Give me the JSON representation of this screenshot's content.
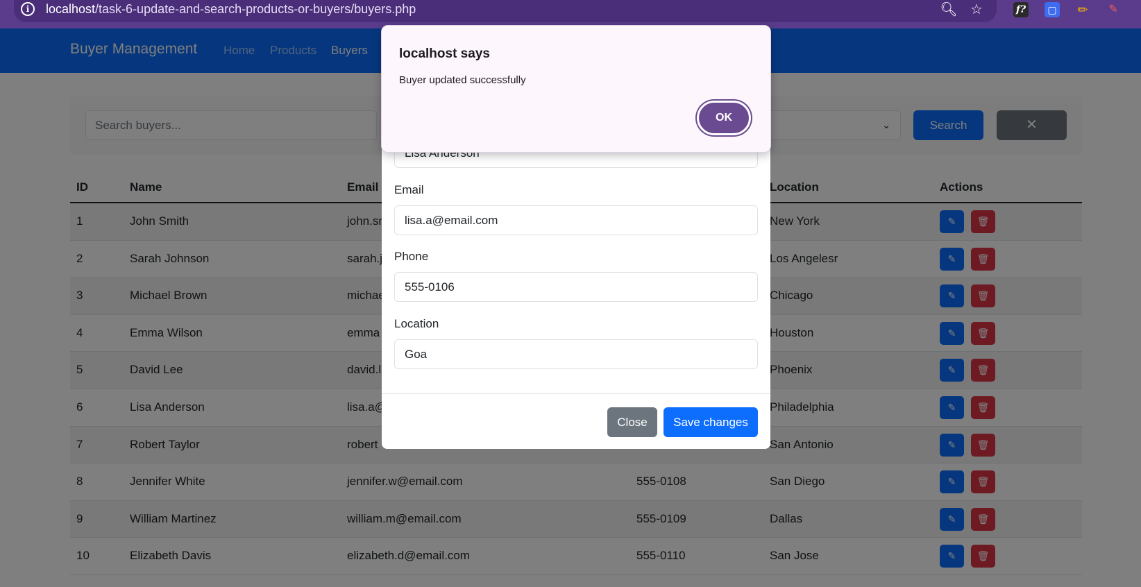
{
  "browser": {
    "url_host": "localhost",
    "url_path": "/task-6-update-and-search-products-or-buyers/buyers.php",
    "extension_f_label": "f?"
  },
  "navbar": {
    "brand": "Buyer Management",
    "links": [
      "Home",
      "Products",
      "Buyers"
    ]
  },
  "search": {
    "placeholder": "Search buyers...",
    "button": "Search",
    "clear": "✕"
  },
  "table": {
    "headers": [
      "ID",
      "Name",
      "Email",
      "Location",
      "Actions"
    ],
    "rows": [
      {
        "id": "1",
        "name": "John Smith",
        "email": "john.sn",
        "phone": "",
        "location": "New York"
      },
      {
        "id": "2",
        "name": "Sarah Johnson",
        "email": "sarah.j",
        "phone": "",
        "location": "Los Angelesr"
      },
      {
        "id": "3",
        "name": "Michael Brown",
        "email": "michae",
        "phone": "",
        "location": "Chicago"
      },
      {
        "id": "4",
        "name": "Emma Wilson",
        "email": "emma",
        "phone": "",
        "location": "Houston"
      },
      {
        "id": "5",
        "name": "David Lee",
        "email": "david.l",
        "phone": "",
        "location": "Phoenix"
      },
      {
        "id": "6",
        "name": "Lisa Anderson",
        "email": "lisa.a@",
        "phone": "",
        "location": "Philadelphia"
      },
      {
        "id": "7",
        "name": "Robert Taylor",
        "email": "robert",
        "phone": "",
        "location": "San Antonio"
      },
      {
        "id": "8",
        "name": "Jennifer White",
        "email": "jennifer.w@email.com",
        "phone": "555-0108",
        "location": "San Diego"
      },
      {
        "id": "9",
        "name": "William Martinez",
        "email": "william.m@email.com",
        "phone": "555-0109",
        "location": "Dallas"
      },
      {
        "id": "10",
        "name": "Elizabeth Davis",
        "email": "elizabeth.d@email.com",
        "phone": "555-0110",
        "location": "San Jose"
      }
    ]
  },
  "modal": {
    "name_value": "Lisa Anderson",
    "email_label": "Email",
    "email_value": "lisa.a@email.com",
    "phone_label": "Phone",
    "phone_value": "555-0106",
    "location_label": "Location",
    "location_value": "Goa",
    "close_button": "Close",
    "save_button": "Save changes"
  },
  "alert": {
    "title": "localhost says",
    "message": "Buyer updated successfully",
    "ok_button": "OK"
  }
}
